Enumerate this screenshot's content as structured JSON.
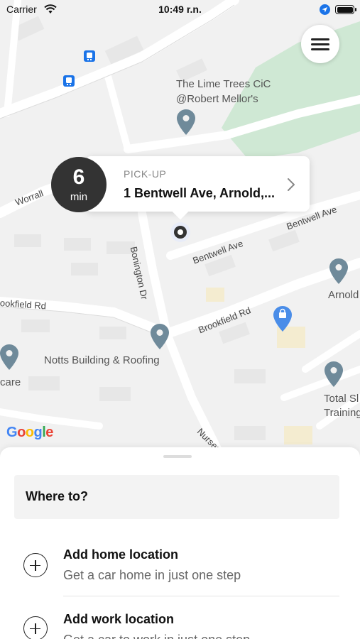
{
  "status_bar": {
    "carrier": "Carrier",
    "time": "10:49 r.n."
  },
  "map": {
    "labels": {
      "lime_trees_line1": "The Lime Trees CiC",
      "lime_trees_line2": "@Robert Mellor's",
      "worrall": "Worrall",
      "bonington": "Bonington Dr",
      "bentwell_1": "Bentwell Ave",
      "bentwell_2": "Bentwell Ave",
      "brookfield_left": "ookfield Rd",
      "brookfield_right": "Brookfield Rd",
      "arnold": "Arnold",
      "notts_building": "Notts Building & Roofing",
      "care": "care",
      "total_line1": "Total Sl",
      "total_line2": "Training",
      "nursery": "Nurser"
    },
    "google_logo": {
      "letters": [
        "G",
        "o",
        "o",
        "g",
        "l",
        "e"
      ],
      "colors": [
        "#4285F4",
        "#EA4335",
        "#FBBC05",
        "#4285F4",
        "#34A853",
        "#EA4335"
      ]
    },
    "colors": {
      "park": "#cfe8d4",
      "pin": "#6f8a9a",
      "shop_pin": "#4a8de8",
      "bus_stop": "#1a73e8"
    }
  },
  "pickup": {
    "eta_value": "6",
    "eta_unit": "min",
    "label": "PICK-UP",
    "address": "1 Bentwell Ave, Arnold,..."
  },
  "sheet": {
    "where_to": "Where to?",
    "items": [
      {
        "title": "Add home location",
        "subtitle": "Get a car home in just one step"
      },
      {
        "title": "Add work location",
        "subtitle": "Get a car to work in just one step"
      }
    ]
  }
}
